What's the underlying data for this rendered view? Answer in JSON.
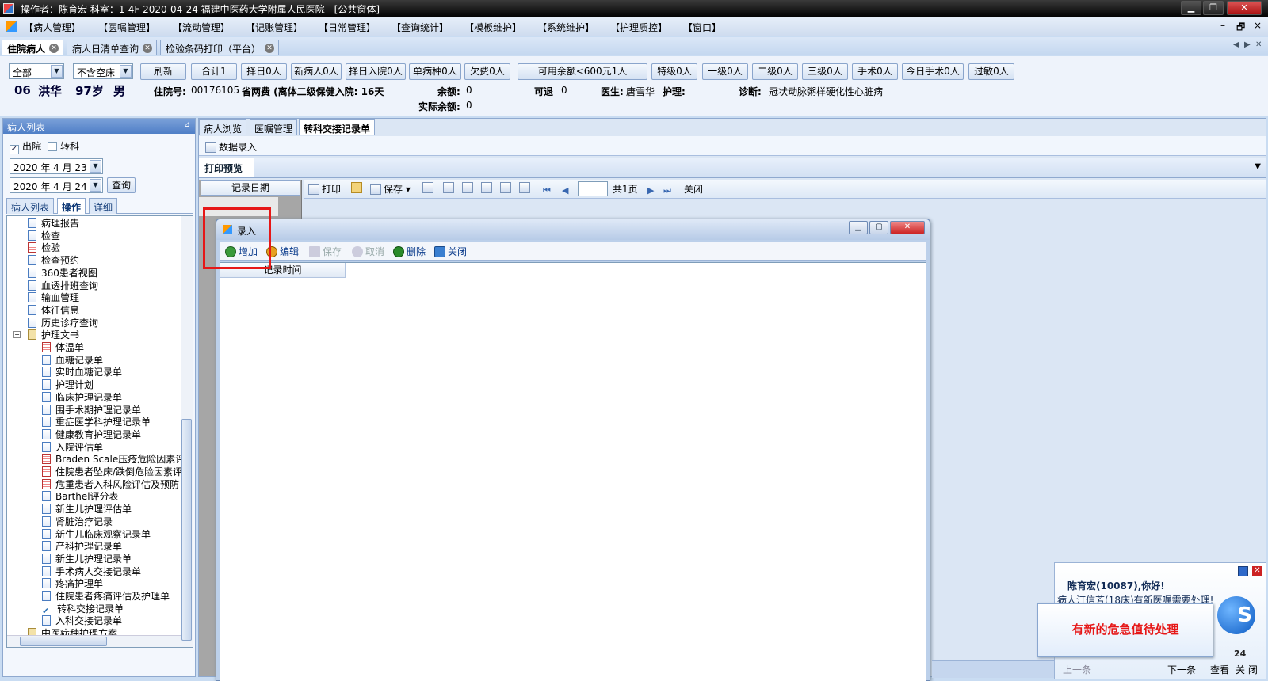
{
  "window": {
    "title": "操作者：陈育宏 科室：1-4F 2020-04-24 福建中医药大学附属人民医院 - [公共窗体]",
    "controls": [
      "▁",
      "❐",
      "✕"
    ]
  },
  "menu": {
    "items": [
      "【病人管理】",
      "【医嘱管理】",
      "【流动管理】",
      "【记账管理】",
      "【日常管理】",
      "【查询统计】",
      "【模板维护】",
      "【系统维护】",
      "【护理质控】",
      "【窗口】"
    ],
    "mdi_controls": [
      "–",
      "🗗",
      "×"
    ]
  },
  "doc_tabs": [
    {
      "label": "住院病人",
      "active": true
    },
    {
      "label": "病人日清单查询",
      "active": false
    },
    {
      "label": "检验条码打印（平台）",
      "active": false
    }
  ],
  "filters": {
    "scope_select": "全部",
    "bed_select": "不含空床",
    "buttons": [
      "刷新",
      "合计1",
      "择日0人",
      "新病人0人",
      "择日入院0人",
      "单病种0人",
      "欠费0人",
      "可用余额<600元1人",
      "特级0人",
      "一级0人",
      "二级0人",
      "三级0人",
      "手术0人",
      "今日手术0人",
      "过敏0人"
    ]
  },
  "patient": {
    "bed": "06",
    "name": "洪华",
    "age": "97岁",
    "sex": "男",
    "admission_label": "住院号:",
    "admission_no": "00176105",
    "insurance_text": "省两费 (离体二级保健入院: 16天",
    "balance_label": "余额:",
    "balance": "0",
    "actual_balance_label": "实际余额:",
    "actual_balance": "0",
    "refundable_label": "可退",
    "refundable": "0",
    "doctor_label": "医生:",
    "doctor": "唐雪华",
    "nurse_label": "护理:",
    "nurse": "",
    "diagnosis_label": "诊断:",
    "diagnosis": "冠状动脉粥样硬化性心脏病"
  },
  "left_panel": {
    "title": "病人列表",
    "pin": "⊿",
    "check_discharged": "出院",
    "check_transfer": "转科",
    "date_from": "2020 年 4 月 23 日",
    "date_to": "2020 年 4 月 24 日",
    "query_button": "查询",
    "tabs": [
      {
        "label": "病人列表",
        "active": false
      },
      {
        "label": "操作",
        "active": true
      },
      {
        "label": "详细",
        "active": false
      }
    ],
    "tree": [
      {
        "label": "病理报告",
        "icon": "doc"
      },
      {
        "label": "检查",
        "icon": "doc"
      },
      {
        "label": "检验",
        "icon": "red"
      },
      {
        "label": "检查预约",
        "icon": "doc"
      },
      {
        "label": "360患者视图",
        "icon": "doc"
      },
      {
        "label": "血透排班查询",
        "icon": "doc"
      },
      {
        "label": "输血管理",
        "icon": "doc"
      },
      {
        "label": "体征信息",
        "icon": "doc"
      },
      {
        "label": "历史诊疗查询",
        "icon": "doc"
      },
      {
        "label": "护理文书",
        "icon": "folder"
      },
      {
        "label": "体温单",
        "icon": "red"
      },
      {
        "label": "血糖记录单",
        "icon": "doc"
      },
      {
        "label": "实时血糖记录单",
        "icon": "doc"
      },
      {
        "label": "护理计划",
        "icon": "doc"
      },
      {
        "label": "临床护理记录单",
        "icon": "doc"
      },
      {
        "label": "围手术期护理记录单",
        "icon": "doc"
      },
      {
        "label": "重症医学科护理记录单",
        "icon": "doc"
      },
      {
        "label": "健康教育护理记录单",
        "icon": "doc"
      },
      {
        "label": "入院评估单",
        "icon": "doc"
      },
      {
        "label": "Braden Scale压疮危险因素评",
        "icon": "red"
      },
      {
        "label": "住院患者坠床/跌倒危险因素评",
        "icon": "red"
      },
      {
        "label": "危重患者入科风险评估及预防",
        "icon": "red"
      },
      {
        "label": "Barthel评分表",
        "icon": "doc"
      },
      {
        "label": "新生儿护理评估单",
        "icon": "doc"
      },
      {
        "label": "肾脏治疗记录",
        "icon": "doc"
      },
      {
        "label": "新生儿临床观察记录单",
        "icon": "doc"
      },
      {
        "label": "产科护理记录单",
        "icon": "doc"
      },
      {
        "label": "新生儿护理记录单",
        "icon": "doc"
      },
      {
        "label": "手术病人交接记录单",
        "icon": "doc"
      },
      {
        "label": "疼痛护理单",
        "icon": "doc"
      },
      {
        "label": "住院患者疼痛评估及护理单",
        "icon": "doc"
      },
      {
        "label": "转科交接记录单",
        "icon": "check"
      },
      {
        "label": "入科交接记录单",
        "icon": "doc"
      },
      {
        "label": "中医病种护理方案",
        "icon": "folder"
      }
    ]
  },
  "right_panel": {
    "tabs": [
      {
        "label": "病人浏览",
        "active": false
      },
      {
        "label": "医嘱管理",
        "active": false
      },
      {
        "label": "转科交接记录单",
        "active": true
      }
    ],
    "data_entry": "数据录入",
    "print_preview_tab": "打印预览",
    "record_date_header": "记录日期",
    "toolbar": {
      "print": "打印",
      "save": "保存",
      "total_pages": "共1页",
      "close": "关闭",
      "page_value": ""
    }
  },
  "modal": {
    "title": "录入",
    "toolbar": {
      "add": "增加",
      "edit": "编辑",
      "save": "保存",
      "cancel": "取消",
      "delete": "删除",
      "close": "关闭"
    },
    "column_header": "记录时间"
  },
  "notification": {
    "greeting": "陈育宏(10087),你好!",
    "message": "病人汀信芳(18床)有新医嘱需要处理!",
    "logo_letter": "S",
    "date": "24",
    "prev": "上一条",
    "next": "下一条",
    "view": "查看",
    "close": "关 闭"
  },
  "alert": {
    "text": "有新的危急值待处理"
  },
  "colors": {
    "highlight": "#e61717",
    "alert_text": "#e61717"
  }
}
